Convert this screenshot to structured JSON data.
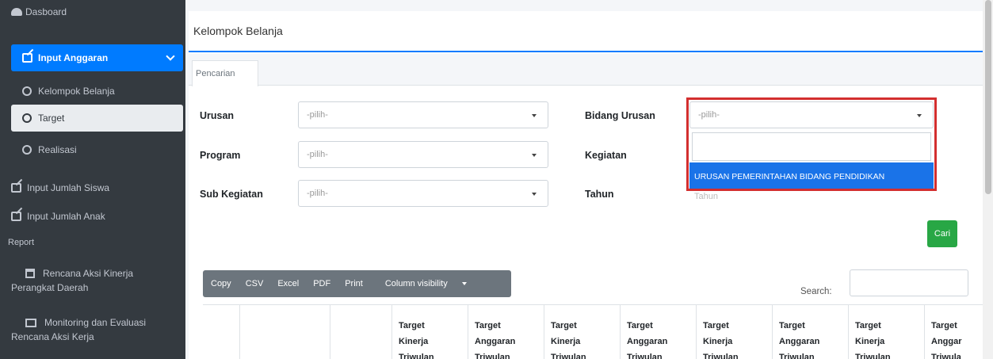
{
  "sidebar": {
    "dashboard": "Dasboard",
    "input_anggaran": "Input Anggaran",
    "sub_items": [
      "Kelompok Belanja",
      "Target",
      "Realisasi"
    ],
    "input_jumlah_siswa": "Input Jumlah Siswa",
    "input_jumlah_anak": "Input Jumlah Anak",
    "report_header": "Report",
    "rencana_aksi_line1": "Rencana Aksi Kinerja",
    "rencana_aksi_line2": "Perangkat Daerah",
    "monev_line1": "Monitoring dan Evaluasi",
    "monev_line2": "Rencana Aksi Kerja"
  },
  "page": {
    "title": "Kelompok Belanja",
    "tab": "Pencarian"
  },
  "form": {
    "urusan_label": "Urusan",
    "urusan_value": "-pilih-",
    "program_label": "Program",
    "program_value": "-pilih-",
    "sub_kegiatan_label": "Sub Kegiatan",
    "sub_kegiatan_value": "-pilih-",
    "bidang_urusan_label": "Bidang Urusan",
    "bidang_urusan_value": "-pilih-",
    "kegiatan_label": "Kegiatan",
    "tahun_label": "Tahun",
    "tahun_placeholder": "Tahun",
    "dropdown_option": "URUSAN PEMERINTAHAN BIDANG PENDIDIKAN",
    "cari_button": "Cari"
  },
  "toolbar": {
    "copy": "Copy",
    "csv": "CSV",
    "excel": "Excel",
    "pdf": "PDF",
    "print": "Print",
    "column_visibility": "Column visibility",
    "search_label": "Search:"
  },
  "table": {
    "headers": [
      [
        "Target",
        "Kinerja",
        "Triwulan"
      ],
      [
        "Target",
        "Anggaran",
        "Triwulan"
      ],
      [
        "Target",
        "Kinerja",
        "Triwulan"
      ],
      [
        "Target",
        "Anggaran",
        "Triwulan"
      ],
      [
        "Target",
        "Kinerja",
        "Triwulan"
      ],
      [
        "Target",
        "Anggaran",
        "Triwulan"
      ],
      [
        "Target",
        "Kinerja",
        "Triwulan"
      ],
      [
        "Target",
        "Anggar",
        "Triwula"
      ]
    ]
  },
  "colors": {
    "sidebar_bg": "#343a40",
    "primary": "#007bff",
    "highlight_border": "#d32f2f",
    "success": "#28a745"
  }
}
